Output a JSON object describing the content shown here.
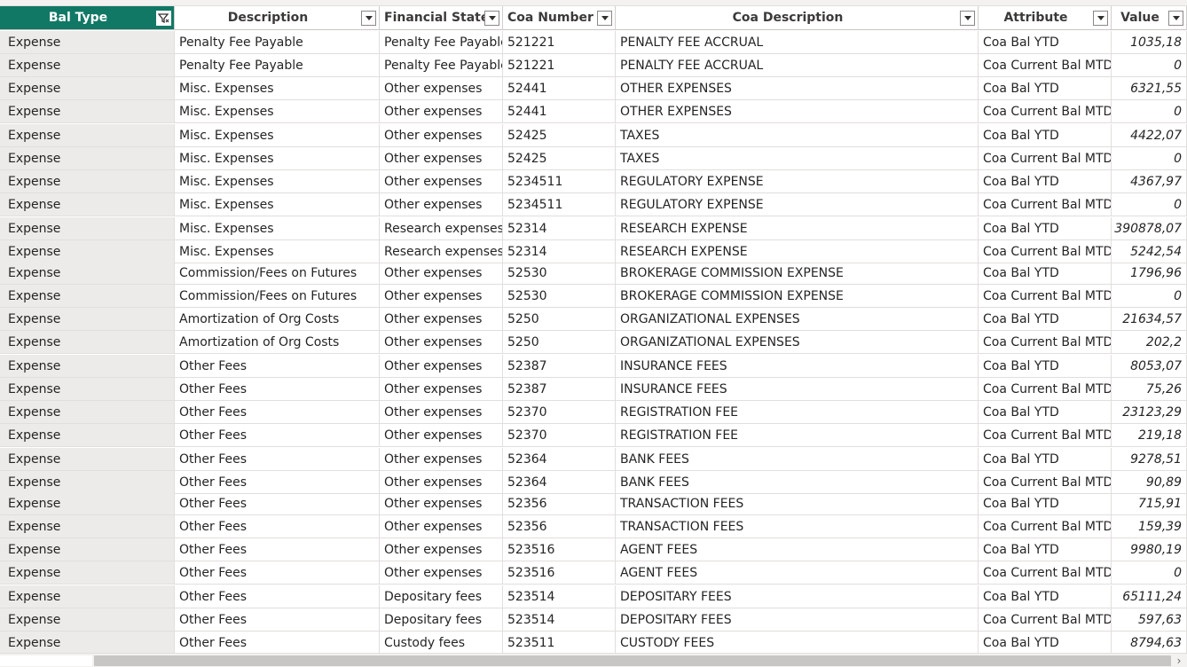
{
  "columns": [
    {
      "label": "Bal Type",
      "icon": "filter-icon"
    },
    {
      "label": "Description",
      "icon": "chevron-down-icon"
    },
    {
      "label": "Financial Stater",
      "icon": "chevron-down-icon"
    },
    {
      "label": "Coa Number",
      "icon": "chevron-down-icon"
    },
    {
      "label": "Coa Description",
      "icon": "chevron-down-icon"
    },
    {
      "label": "Attribute",
      "icon": "chevron-down-icon"
    },
    {
      "label": "Value",
      "icon": "chevron-down-icon"
    }
  ],
  "rows": [
    [
      "Expense",
      "Penalty Fee Payable",
      "Penalty Fee Payable",
      "521221",
      "PENALTY FEE ACCRUAL",
      "Coa Bal YTD",
      "1035,18"
    ],
    [
      "Expense",
      "Penalty Fee Payable",
      "Penalty Fee Payable",
      "521221",
      "PENALTY FEE ACCRUAL",
      "Coa Current Bal MTD",
      "0"
    ],
    [
      "Expense",
      "Misc. Expenses",
      "Other expenses",
      "52441",
      "OTHER EXPENSES",
      "Coa Bal YTD",
      "6321,55"
    ],
    [
      "Expense",
      "Misc. Expenses",
      "Other expenses",
      "52441",
      "OTHER EXPENSES",
      "Coa Current Bal MTD",
      "0"
    ],
    [
      "Expense",
      "Misc. Expenses",
      "Other expenses",
      "52425",
      "TAXES",
      "Coa Bal YTD",
      "4422,07"
    ],
    [
      "Expense",
      "Misc. Expenses",
      "Other expenses",
      "52425",
      "TAXES",
      "Coa Current Bal MTD",
      "0"
    ],
    [
      "Expense",
      "Misc. Expenses",
      "Other expenses",
      "5234511",
      "REGULATORY EXPENSE",
      "Coa Bal YTD",
      "4367,97"
    ],
    [
      "Expense",
      "Misc. Expenses",
      "Other expenses",
      "5234511",
      "REGULATORY EXPENSE",
      "Coa Current Bal MTD",
      "0"
    ],
    [
      "Expense",
      "Misc. Expenses",
      "Research expenses",
      "52314",
      "RESEARCH EXPENSE",
      "Coa Bal YTD",
      "390878,07"
    ],
    [
      "Expense",
      "Misc. Expenses",
      "Research expenses",
      "52314",
      "RESEARCH EXPENSE",
      "Coa Current Bal MTD",
      "5242,54"
    ],
    [
      "Expense",
      "Commission/Fees on Futures",
      "Other expenses",
      "52530",
      "BROKERAGE COMMISSION EXPENSE",
      "Coa Bal YTD",
      "1796,96"
    ],
    [
      "Expense",
      "Commission/Fees on Futures",
      "Other expenses",
      "52530",
      "BROKERAGE COMMISSION EXPENSE",
      "Coa Current Bal MTD",
      "0"
    ],
    [
      "Expense",
      "Amortization of Org Costs",
      "Other expenses",
      "5250",
      "ORGANIZATIONAL EXPENSES",
      "Coa Bal YTD",
      "21634,57"
    ],
    [
      "Expense",
      "Amortization of Org Costs",
      "Other expenses",
      "5250",
      "ORGANIZATIONAL EXPENSES",
      "Coa Current Bal MTD",
      "202,2"
    ],
    [
      "Expense",
      "Other Fees",
      "Other expenses",
      "52387",
      "INSURANCE FEES",
      "Coa Bal YTD",
      "8053,07"
    ],
    [
      "Expense",
      "Other Fees",
      "Other expenses",
      "52387",
      "INSURANCE FEES",
      "Coa Current Bal MTD",
      "75,26"
    ],
    [
      "Expense",
      "Other Fees",
      "Other expenses",
      "52370",
      "REGISTRATION FEE",
      "Coa Bal YTD",
      "23123,29"
    ],
    [
      "Expense",
      "Other Fees",
      "Other expenses",
      "52370",
      "REGISTRATION FEE",
      "Coa Current Bal MTD",
      "219,18"
    ],
    [
      "Expense",
      "Other Fees",
      "Other expenses",
      "52364",
      "BANK FEES",
      "Coa Bal YTD",
      "9278,51"
    ],
    [
      "Expense",
      "Other Fees",
      "Other expenses",
      "52364",
      "BANK FEES",
      "Coa Current Bal MTD",
      "90,89"
    ],
    [
      "Expense",
      "Other Fees",
      "Other expenses",
      "52356",
      "TRANSACTION FEES",
      "Coa Bal YTD",
      "715,91"
    ],
    [
      "Expense",
      "Other Fees",
      "Other expenses",
      "52356",
      "TRANSACTION FEES",
      "Coa Current Bal MTD",
      "159,39"
    ],
    [
      "Expense",
      "Other Fees",
      "Other expenses",
      "523516",
      "AGENT FEES",
      "Coa Bal YTD",
      "9980,19"
    ],
    [
      "Expense",
      "Other Fees",
      "Other expenses",
      "523516",
      "AGENT FEES",
      "Coa Current Bal MTD",
      "0"
    ],
    [
      "Expense",
      "Other Fees",
      "Depositary fees",
      "523514",
      "DEPOSITARY FEES",
      "Coa Bal YTD",
      "65111,24"
    ],
    [
      "Expense",
      "Other Fees",
      "Depositary fees",
      "523514",
      "DEPOSITARY FEES",
      "Coa Current Bal MTD",
      "597,63"
    ],
    [
      "Expense",
      "Other Fees",
      "Custody fees",
      "523511",
      "CUSTODY FEES",
      "Coa Bal YTD",
      "8794,63"
    ]
  ],
  "scrollbar": {
    "right_arrow": "›"
  },
  "colors": {
    "header_active": "#117865",
    "first_col_bg": "#edebe9",
    "grid_line": "#e1dfdd"
  }
}
